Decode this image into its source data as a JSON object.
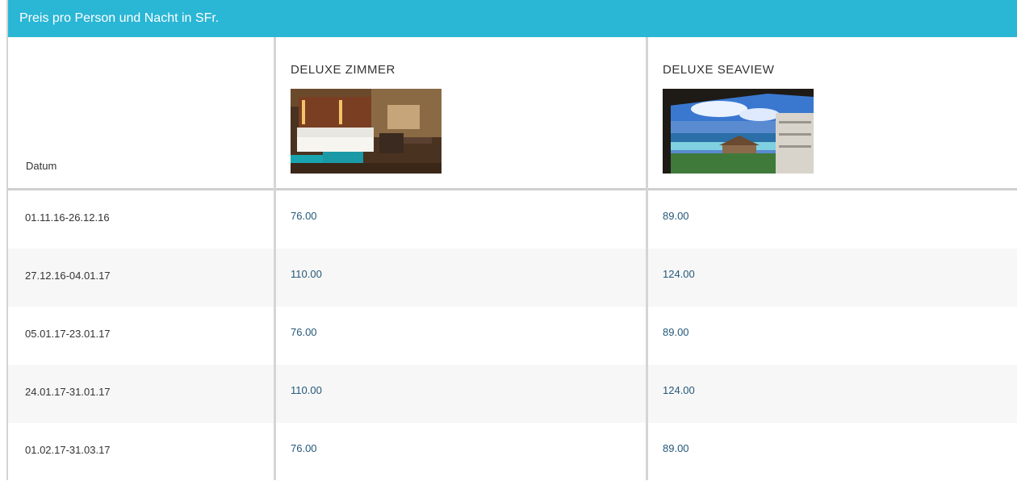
{
  "header": {
    "title": "Preis pro Person und Nacht in SFr."
  },
  "table": {
    "date_header": "Datum",
    "columns": [
      {
        "title": "DELUXE ZIMMER",
        "image": "hotel-room-photo"
      },
      {
        "title": "DELUXE SEAVIEW",
        "image": "ocean-view-photo"
      }
    ],
    "rows": [
      {
        "date": "01.11.16-26.12.16",
        "prices": [
          "76.00",
          "89.00"
        ]
      },
      {
        "date": "27.12.16-04.01.17",
        "prices": [
          "110.00",
          "124.00"
        ]
      },
      {
        "date": "05.01.17-23.01.17",
        "prices": [
          "76.00",
          "89.00"
        ]
      },
      {
        "date": "24.01.17-31.01.17",
        "prices": [
          "110.00",
          "124.00"
        ]
      },
      {
        "date": "01.02.17-31.03.17",
        "prices": [
          "76.00",
          "89.00"
        ]
      }
    ]
  },
  "colors": {
    "header_bg": "#2ab6d5",
    "price_text": "#24587a",
    "row_alt_bg": "#f7f7f7",
    "divider": "#d5d5d5"
  }
}
